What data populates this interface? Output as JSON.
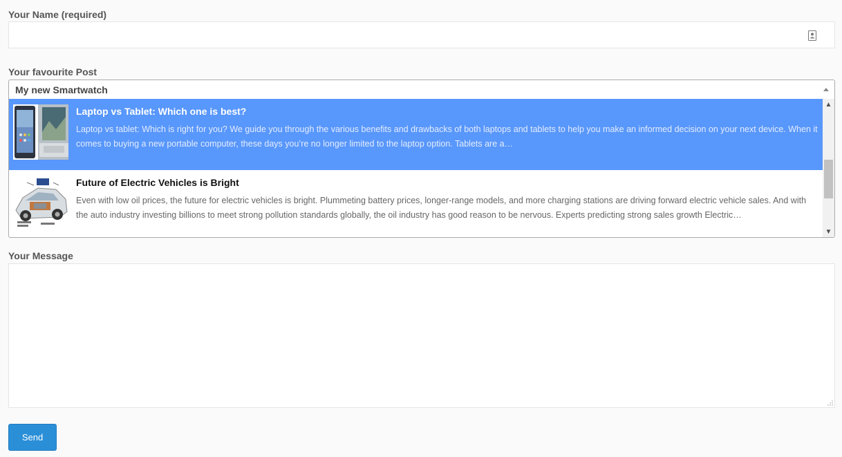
{
  "form": {
    "name_label": "Your Name (required)",
    "name_value": "",
    "post_label": "Your favourite Post",
    "post_selected": "My new Smartwatch",
    "message_label": "Your Message",
    "message_value": "",
    "send_label": "Send"
  },
  "dropdown": {
    "options": [
      {
        "title": "Laptop vs Tablet: Which one is best?",
        "desc": "Laptop vs tablet: Which is right for you? We guide you through the various benefits and drawbacks of both laptops and tablets to help you make an informed decision on your next device. When it comes to buying a new portable computer, these days you’re no longer limited to the laptop option. Tablets are a…",
        "highlighted": true,
        "thumb_icon": "laptop-tablet-thumbnail"
      },
      {
        "title": "Future of Electric Vehicles is Bright",
        "desc": "Even with low oil prices, the future for electric vehicles is bright. Plummeting battery prices, longer-range models, and more charging stations are driving forward electric vehicle sales. And with the auto industry investing billions to meet strong pollution standards globally, the oil industry has good reason to be nervous. Experts predicting strong sales growth Electric…",
        "highlighted": false,
        "thumb_icon": "electric-car-thumbnail"
      }
    ]
  },
  "colors": {
    "highlight": "#5897fb",
    "send_button": "#2b8fd8"
  }
}
